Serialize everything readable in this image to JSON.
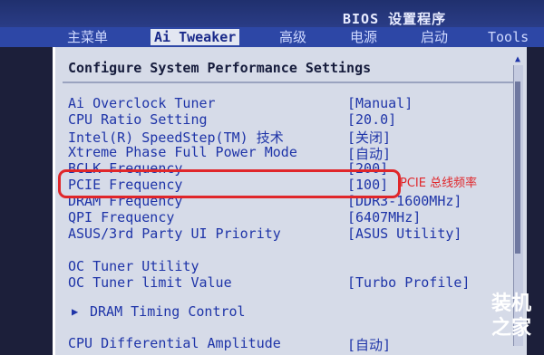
{
  "window": {
    "title": "BIOS 设置程序"
  },
  "tabs": [
    {
      "label": "主菜单"
    },
    {
      "label": "Ai Tweaker"
    },
    {
      "label": "高级"
    },
    {
      "label": "电源"
    },
    {
      "label": "启动"
    },
    {
      "label": "Tools"
    }
  ],
  "panel": {
    "header": "Configure System Performance Settings"
  },
  "settings": [
    {
      "label": "Ai Overclock Tuner",
      "value": "[Manual]"
    },
    {
      "label": "CPU Ratio Setting",
      "value": "[20.0]"
    },
    {
      "label": "Intel(R) SpeedStep(TM) 技术",
      "value": "[关闭]"
    },
    {
      "label": "Xtreme Phase Full Power Mode",
      "value": "[自动]"
    },
    {
      "label": "BCLK Frequency",
      "value": "[200]"
    },
    {
      "label": "PCIE Frequency",
      "value": "[100]"
    },
    {
      "label": "DRAM Frequency",
      "value": "[DDR3-1600MHz]"
    },
    {
      "label": "QPI Frequency",
      "value": "[6407MHz]"
    },
    {
      "label": "ASUS/3rd Party UI Priority",
      "value": "[ASUS Utility]"
    },
    {
      "label": "OC Tuner Utility",
      "value": ""
    },
    {
      "label": "OC Tuner limit Value",
      "value": "[Turbo Profile]"
    },
    {
      "label": "DRAM Timing Control",
      "value": ""
    },
    {
      "label": "CPU Differential Amplitude",
      "value": "[自动]"
    }
  ],
  "submenu_marker": "▶",
  "annotation": {
    "text": "PCIE 总线频率",
    "color": "#e0262a"
  },
  "watermark": {
    "line1": "装机",
    "line2": "之家"
  },
  "colors": {
    "panel_bg": "#d6dbe8",
    "text_blue": "#1e34a8",
    "tab_bar": "#2d47a6"
  }
}
